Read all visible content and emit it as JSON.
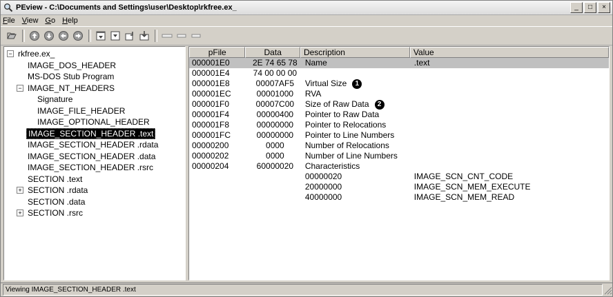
{
  "window": {
    "title": "PEview - C:\\Documents and Settings\\user\\Desktop\\rkfree.ex_"
  },
  "menu": [
    {
      "key": "F",
      "rest": "ile"
    },
    {
      "key": "V",
      "rest": "iew"
    },
    {
      "key": "G",
      "rest": "o"
    },
    {
      "key": "H",
      "rest": "elp"
    }
  ],
  "tree": [
    {
      "label": "rkfree.ex_",
      "expander": "−"
    },
    {
      "label": "IMAGE_DOS_HEADER"
    },
    {
      "label": "MS-DOS Stub Program"
    },
    {
      "label": "IMAGE_NT_HEADERS",
      "expander": "−"
    },
    {
      "label": "Signature"
    },
    {
      "label": "IMAGE_FILE_HEADER"
    },
    {
      "label": "IMAGE_OPTIONAL_HEADER"
    },
    {
      "label": "IMAGE_SECTION_HEADER .text",
      "selected": true
    },
    {
      "label": "IMAGE_SECTION_HEADER .rdata"
    },
    {
      "label": "IMAGE_SECTION_HEADER .data"
    },
    {
      "label": "IMAGE_SECTION_HEADER .rsrc"
    },
    {
      "label": "SECTION .text"
    },
    {
      "label": "SECTION .rdata",
      "expander": "+"
    },
    {
      "label": "SECTION .data"
    },
    {
      "label": "SECTION .rsrc",
      "expander": "+"
    }
  ],
  "columns": [
    "pFile",
    "Data",
    "Description",
    "Value"
  ],
  "rows": [
    {
      "pfile": "000001E0",
      "data": "2E 74 65 78",
      "desc": "Name",
      "value": ".text",
      "selected": true
    },
    {
      "pfile": "000001E4",
      "data": "74 00 00 00",
      "desc": "",
      "value": ""
    },
    {
      "pfile": "000001E8",
      "data": "00007AF5",
      "desc": "Virtual Size",
      "value": "",
      "badge": "1"
    },
    {
      "pfile": "000001EC",
      "data": "00001000",
      "desc": "RVA",
      "value": ""
    },
    {
      "pfile": "000001F0",
      "data": "00007C00",
      "desc": "Size of Raw Data",
      "value": "",
      "badge": "2"
    },
    {
      "pfile": "000001F4",
      "data": "00000400",
      "desc": "Pointer to Raw Data",
      "value": ""
    },
    {
      "pfile": "000001F8",
      "data": "00000000",
      "desc": "Pointer to Relocations",
      "value": ""
    },
    {
      "pfile": "000001FC",
      "data": "00000000",
      "desc": "Pointer to Line Numbers",
      "value": ""
    },
    {
      "pfile": "00000200",
      "data": "0000",
      "desc": "Number of Relocations",
      "value": ""
    },
    {
      "pfile": "00000202",
      "data": "0000",
      "desc": "Number of Line Numbers",
      "value": ""
    },
    {
      "pfile": "00000204",
      "data": "60000020",
      "desc": "Characteristics",
      "value": ""
    },
    {
      "pfile": "",
      "data": "",
      "desc": "00000020",
      "value": "IMAGE_SCN_CNT_CODE"
    },
    {
      "pfile": "",
      "data": "",
      "desc": "20000000",
      "value": "IMAGE_SCN_MEM_EXECUTE"
    },
    {
      "pfile": "",
      "data": "",
      "desc": "40000000",
      "value": "IMAGE_SCN_MEM_READ"
    }
  ],
  "status": "Viewing IMAGE_SECTION_HEADER .text"
}
